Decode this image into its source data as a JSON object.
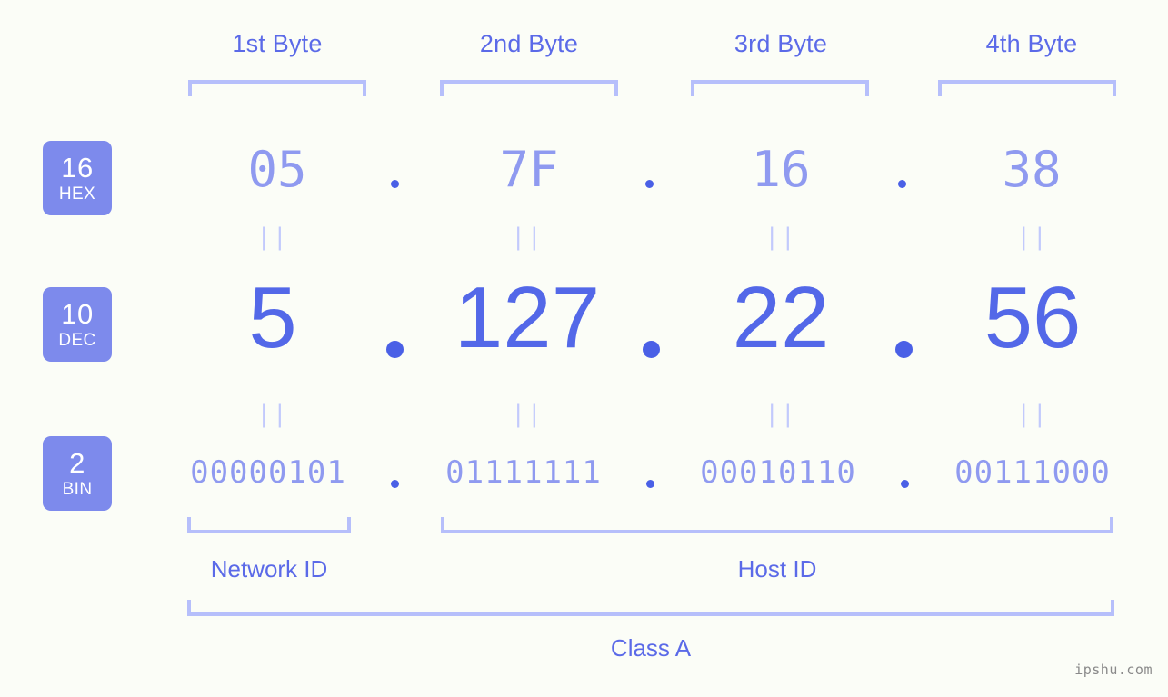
{
  "theme": {
    "background": "#fbfdf7",
    "badge_bg": "#7d8aec",
    "badge_text": "#ffffff",
    "accent_strong": "#5368e8",
    "accent_light": "#8f9af0",
    "bracket": "#b6bffb",
    "label": "#5b6ae8",
    "eq_mark": "#c2cafc",
    "watermark": "#8a8a8a"
  },
  "byte_headers": [
    {
      "label": "1st Byte"
    },
    {
      "label": "2nd Byte"
    },
    {
      "label": "3rd Byte"
    },
    {
      "label": "4th Byte"
    }
  ],
  "rows": [
    {
      "base": "16",
      "system": "HEX",
      "values": [
        "05",
        "7F",
        "16",
        "38"
      ],
      "separator": "."
    },
    {
      "base": "10",
      "system": "DEC",
      "values": [
        "5",
        "127",
        "22",
        "56"
      ],
      "separator": "."
    },
    {
      "base": "2",
      "system": "BIN",
      "values": [
        "00000101",
        "01111111",
        "00010110",
        "00111000"
      ],
      "separator": "."
    }
  ],
  "equality_mark": "||",
  "sections": {
    "network_id": "Network ID",
    "host_id": "Host ID",
    "class": "Class A"
  },
  "watermark": "ipshu.com"
}
